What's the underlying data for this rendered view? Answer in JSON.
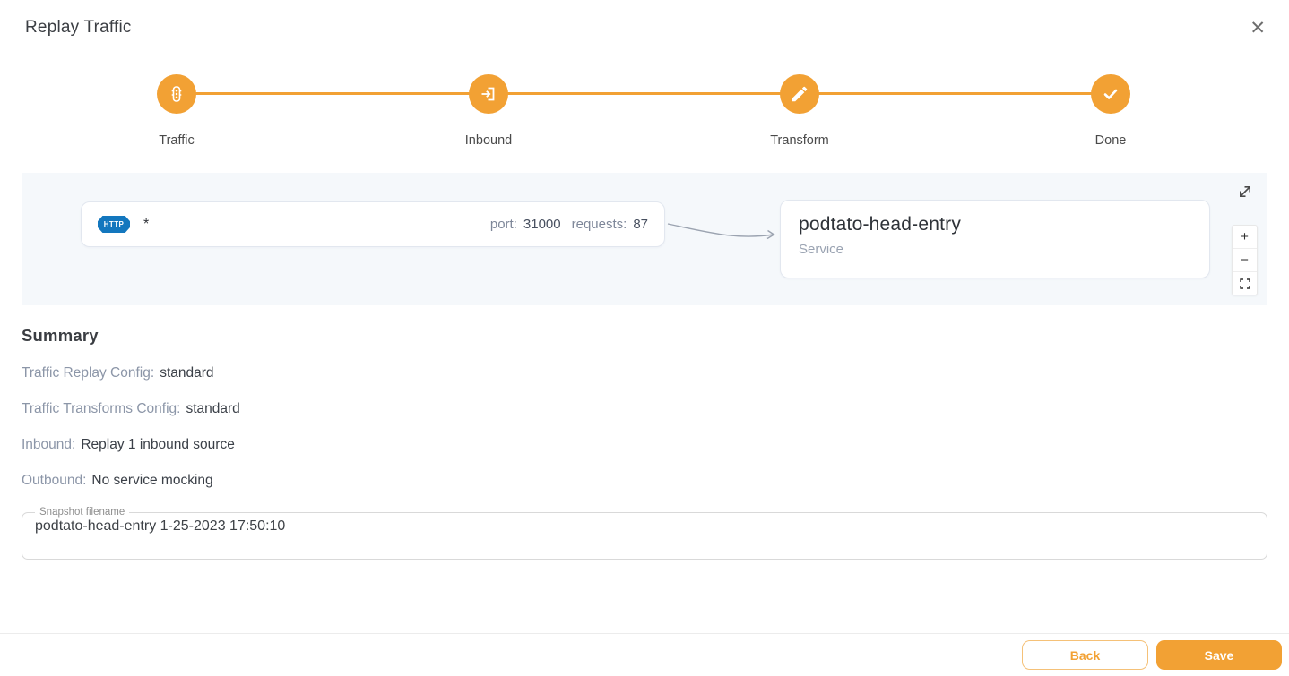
{
  "dialog": {
    "title": "Replay Traffic"
  },
  "icons": {
    "close": "✕"
  },
  "stepper": {
    "steps": [
      {
        "label": "Traffic",
        "icon": "traffic-light-icon"
      },
      {
        "label": "Inbound",
        "icon": "sign-in-icon"
      },
      {
        "label": "Transform",
        "icon": "pencil-icon"
      },
      {
        "label": "Done",
        "icon": "check-icon"
      }
    ]
  },
  "diagram": {
    "source_node": {
      "protocol": "HTTP",
      "path": "*",
      "port_label": "port:",
      "port_value": "31000",
      "requests_label": "requests:",
      "requests_value": "87"
    },
    "service_node": {
      "title": "podtato-head-entry",
      "subtitle": "Service"
    },
    "controls": {
      "zoom_in": "+",
      "zoom_out": "−"
    }
  },
  "summary": {
    "heading": "Summary",
    "rows": [
      {
        "label": "Traffic Replay Config:",
        "value": "standard"
      },
      {
        "label": "Traffic Transforms Config:",
        "value": "standard"
      },
      {
        "label": "Inbound:",
        "value": "Replay 1 inbound source"
      },
      {
        "label": "Outbound:",
        "value": "No service mocking"
      }
    ]
  },
  "snapshot_field": {
    "label": "Snapshot filename",
    "value": "podtato-head-entry 1-25-2023 17:50:10"
  },
  "footer": {
    "back": "Back",
    "save": "Save"
  },
  "colors": {
    "accent_orange": "#F2A134",
    "badge_blue": "#1377BE",
    "canvas_background": "#F5F8FB"
  }
}
